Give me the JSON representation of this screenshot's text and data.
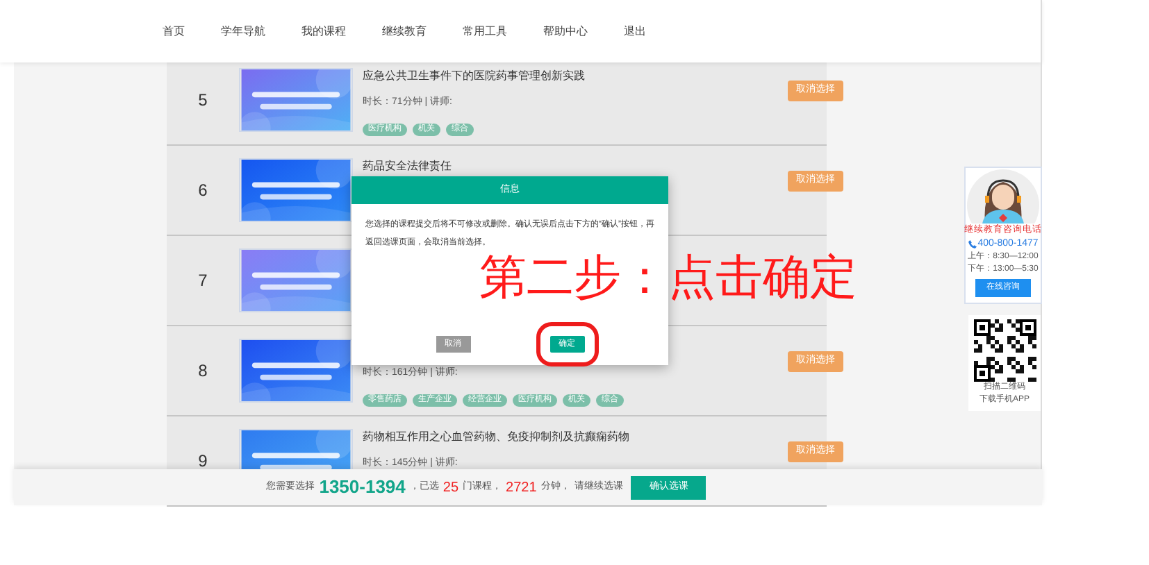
{
  "nav": [
    {
      "label": "首页"
    },
    {
      "label": "学年导航"
    },
    {
      "label": "我的课程"
    },
    {
      "label": "继续教育"
    },
    {
      "label": "常用工具"
    },
    {
      "label": "帮助中心"
    },
    {
      "label": "退出"
    }
  ],
  "courses": [
    {
      "number": "5",
      "title": "应急公共卫生事件下的医院药事管理创新实践",
      "duration": "时长：71分钟 | 讲师:",
      "tags": [
        "医疗机构",
        "机关",
        "综合"
      ],
      "action": "取消选择"
    },
    {
      "number": "6",
      "title": "药品安全法律责任",
      "action": "取消选择"
    },
    {
      "number": "7"
    },
    {
      "number": "8",
      "duration": "时长：161分钟 | 讲师:",
      "tags": [
        "零售药店",
        "生产企业",
        "经营企业",
        "医疗机构",
        "机关",
        "综合"
      ],
      "action": "取消选择"
    },
    {
      "number": "9",
      "title": "药物相互作用之心血管药物、免疫抑制剂及抗癫痫药物",
      "duration": "时长：145分钟 | 讲师:",
      "action": "取消选择"
    }
  ],
  "dialog": {
    "title": "信息",
    "message": "您选择的课程提交后将不可修改或删除。确认无误后点击下方的“确认”按钮，再返回选课页面，会取消当前选择。",
    "buttons": [
      {
        "label": "取消",
        "kind": "secondary"
      },
      {
        "label": "确定",
        "kind": "primary",
        "highlighted": true
      }
    ]
  },
  "annotation": "第二步：点击确定",
  "contact": {
    "title": "继续教育咨询电话",
    "phone": "400-800-1477",
    "hours": [
      "上午：8:30—12:00",
      "下午：13:00—5:30"
    ],
    "button": "在线咨询"
  },
  "qr": {
    "caption": [
      "扫描二维码",
      "下载手机APP"
    ]
  },
  "footer": {
    "parts": [
      {
        "kind": "text",
        "text": "您需要选择"
      },
      {
        "kind": "range",
        "text": "1350-1394"
      },
      {
        "kind": "text",
        "text": "，已选"
      },
      {
        "kind": "count",
        "text": "25"
      },
      {
        "kind": "text",
        "text": "门课程，"
      },
      {
        "kind": "count",
        "text": "2721"
      },
      {
        "kind": "text",
        "text": "分钟，"
      },
      {
        "kind": "text",
        "text": "请继续选课"
      }
    ],
    "button": "确认选课"
  }
}
